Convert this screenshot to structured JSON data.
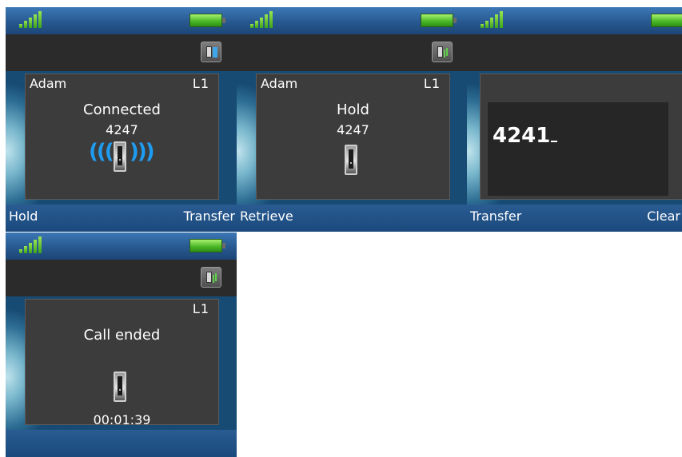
{
  "colors": {
    "status_bar": "#27598f",
    "title_bar": "#2b2b2b",
    "card": "#3c3c3c",
    "softkey_bar": "#1e4f82",
    "signal": "#5cc52a",
    "battery": "#47b524",
    "call_waves": "#1f9cf0"
  },
  "screens": [
    {
      "icons": {
        "signal": "signal-strength-icon",
        "battery": "battery-icon",
        "call_state": "call-transfer-icon"
      },
      "contact_name": "Adam",
      "line": "L1",
      "call_state": "Connected",
      "number": "4247",
      "softkeys": {
        "left": "Hold",
        "right": "Transfer"
      }
    },
    {
      "icons": {
        "signal": "signal-strength-icon",
        "battery": "battery-icon",
        "call_state": "call-hold-icon"
      },
      "contact_name": "Adam",
      "line": "L1",
      "call_state": "Hold",
      "number": "4247",
      "softkeys": {
        "left": "Retrieve",
        "right": ""
      }
    },
    {
      "icons": {
        "signal": "signal-strength-icon",
        "battery": "battery-icon"
      },
      "entry_value": "4241",
      "softkeys": {
        "left": "Transfer",
        "right": "Clear"
      }
    },
    {
      "icons": {
        "signal": "signal-strength-icon",
        "battery": "battery-icon",
        "call_state": "call-hold-icon"
      },
      "line": "L1",
      "call_state": "Call ended",
      "duration": "00:01:39",
      "softkeys": {
        "left": "",
        "right": ""
      }
    }
  ]
}
